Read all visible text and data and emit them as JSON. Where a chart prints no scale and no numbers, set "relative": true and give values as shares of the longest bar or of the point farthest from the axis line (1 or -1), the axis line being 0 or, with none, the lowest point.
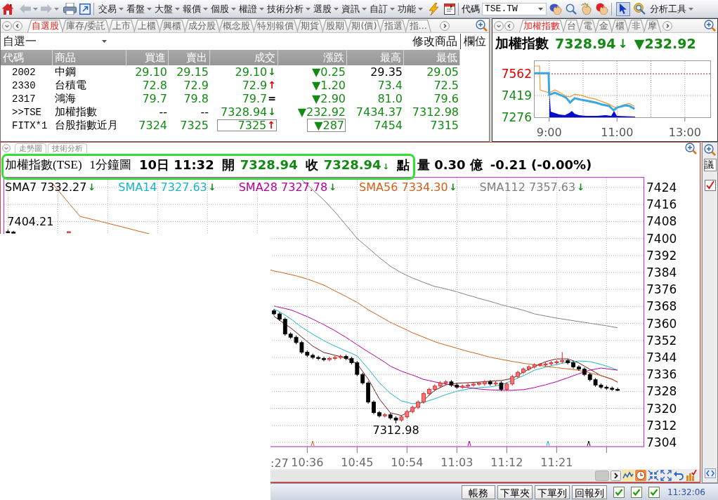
{
  "toolbar": {
    "back": {
      "disabled": true
    },
    "forward": {
      "disabled": true
    },
    "menus": [
      "交易",
      "看盤",
      "大盤",
      "報價",
      "個股",
      "權證",
      "技術分析",
      "選股",
      "資訊",
      "自訂",
      "功能"
    ],
    "code_label": "代碼",
    "code_value": "TSE.TW",
    "pointer_active": true,
    "tools_menu": "分析工具"
  },
  "watchlist": {
    "tabs": [
      {
        "label": "自選股",
        "selected": true
      },
      {
        "label": "庫存/委託",
        "selected": false
      },
      {
        "label": "上市",
        "selected": false
      },
      {
        "label": "上櫃",
        "selected": false
      },
      {
        "label": "興櫃",
        "selected": false
      },
      {
        "label": "成分股",
        "selected": false
      },
      {
        "label": "概念股",
        "selected": false
      },
      {
        "label": "特別報價",
        "selected": false
      },
      {
        "label": "期貨",
        "selected": false
      },
      {
        "label": "股期",
        "selected": false
      },
      {
        "label": "期(價)",
        "selected": false
      },
      {
        "label": "指選",
        "selected": false
      },
      {
        "label": "指...",
        "selected": false
      }
    ],
    "list_name": "自選一",
    "buttons": [
      "修改商品",
      "欄位"
    ],
    "columns": [
      "代碼",
      "商品",
      "買進",
      "賣出",
      "成交",
      "漲跌",
      "最高",
      "最低"
    ],
    "rows": [
      {
        "highlighted": false,
        "cells": [
          {
            "text": "2002",
            "color": "#000000"
          },
          {
            "text": "中鋼",
            "color": "#000000"
          },
          {
            "text": "29.10",
            "color": "#138a13"
          },
          {
            "text": "29.15",
            "color": "#138a13"
          },
          {
            "text": "29.10",
            "color": "#138a13",
            "tick": {
              "text": "↓",
              "color": "#138a13"
            }
          },
          {
            "text": "▼0.25",
            "color": "#138a13"
          },
          {
            "text": "29.35",
            "color": "#000000"
          },
          {
            "text": "29.05",
            "color": "#138a13"
          }
        ]
      },
      {
        "highlighted": false,
        "cells": [
          {
            "text": "2330",
            "color": "#000000"
          },
          {
            "text": "台積電",
            "color": "#000000"
          },
          {
            "text": "72.8",
            "color": "#138a13"
          },
          {
            "text": "72.9",
            "color": "#138a13"
          },
          {
            "text": "72.9",
            "color": "#138a13",
            "tick": {
              "text": "↑",
              "color": "#e00000"
            }
          },
          {
            "text": "▼1.20",
            "color": "#138a13"
          },
          {
            "text": "73.4",
            "color": "#138a13"
          },
          {
            "text": "72.5",
            "color": "#138a13"
          }
        ]
      },
      {
        "highlighted": false,
        "cells": [
          {
            "text": "2317",
            "color": "#000000"
          },
          {
            "text": "鴻海",
            "color": "#000000"
          },
          {
            "text": "79.7",
            "color": "#138a13"
          },
          {
            "text": "79.8",
            "color": "#138a13"
          },
          {
            "text": "79.7",
            "color": "#138a13",
            "tick": {
              "text": "=",
              "color": "#000000"
            }
          },
          {
            "text": "▼2.90",
            "color": "#138a13"
          },
          {
            "text": "81.0",
            "color": "#138a13"
          },
          {
            "text": "79.6",
            "color": "#138a13"
          }
        ]
      },
      {
        "highlighted": false,
        "cells": [
          {
            "text": ">>TSE",
            "color": "#000000"
          },
          {
            "text": "加權指數",
            "color": "#000000"
          },
          {
            "text": "--",
            "color": "#000000"
          },
          {
            "text": "--",
            "color": "#000000"
          },
          {
            "text": "7328.94",
            "color": "#138a13",
            "tick": {
              "text": "↓",
              "color": "#138a13"
            }
          },
          {
            "text": "▼232.92",
            "color": "#138a13"
          },
          {
            "text": "7434.37",
            "color": "#138a13"
          },
          {
            "text": "7312.98",
            "color": "#138a13"
          }
        ]
      },
      {
        "highlighted": true,
        "cells": [
          {
            "text": "FITX*1",
            "color": "#000000"
          },
          {
            "text": "台股指數近月",
            "color": "#000000"
          },
          {
            "text": "7324",
            "color": "#138a13"
          },
          {
            "text": "7325",
            "color": "#138a13"
          },
          {
            "text": "7325",
            "color": "#138a13",
            "tick": {
              "text": "↑",
              "color": "#e00000"
            }
          },
          {
            "text": "▼287",
            "color": "#138a13"
          },
          {
            "text": "7454",
            "color": "#138a13"
          },
          {
            "text": "7315",
            "color": "#138a13"
          }
        ]
      }
    ]
  },
  "index_panel": {
    "tabs": [
      {
        "label": "加權指數",
        "selected": true
      },
      {
        "label": "台",
        "selected": false
      },
      {
        "label": "電",
        "selected": false
      },
      {
        "label": "金",
        "selected": false
      },
      {
        "label": "櫃",
        "selected": false
      },
      {
        "label": "非",
        "selected": false
      },
      {
        "label": "摩",
        "selected": false
      }
    ],
    "name": "加權指數",
    "value": "7328.94",
    "arrow": "↓",
    "change": "▼232.92",
    "chart_data": {
      "type": "line",
      "x": [
        514,
        523,
        524,
        531,
        539,
        540,
        550,
        562,
        570,
        577,
        585,
        597,
        610,
        622,
        634,
        646,
        654,
        661,
        668,
        674,
        682,
        691
      ],
      "series": [
        {
          "color": "#f09a30",
          "values": [
            7613,
            7613,
            7456,
            7447,
            7438,
            7437,
            7456,
            7433,
            7415,
            7410,
            7428,
            7421,
            7405,
            7395,
            7378,
            7362,
            7345,
            7338,
            7354,
            7360,
            7366,
            7347
          ]
        },
        {
          "color": "#3aa8e0",
          "values": [
            7566,
            7566,
            7566,
            7566,
            7566,
            7424,
            7437,
            7419,
            7405,
            7373,
            7401,
            7391,
            7382,
            7373,
            7359,
            7350,
            7322,
            7341,
            7347,
            7354,
            7350,
            7331
          ]
        }
      ],
      "xlim": [
        513,
        825
      ],
      "ylim": [
        7276,
        7650
      ],
      "xticks": [
        {
          "value": 540,
          "label": "9:00"
        },
        {
          "value": 660,
          "label": "11:00"
        },
        {
          "value": 780,
          "label": "13:00"
        }
      ],
      "yticks": [
        {
          "value": 7276,
          "label": "7276"
        },
        {
          "value": 7419,
          "label": "7419"
        },
        {
          "value": 7562,
          "label": "7562"
        }
      ],
      "grid": true,
      "ref_lines": [
        {
          "axis": "y",
          "value": 7562
        }
      ]
    }
  },
  "chart_panel": {
    "tabs": [
      "走勢圖",
      "技術分析"
    ],
    "header": {
      "symbol": "加權指數(TSE)",
      "interval": "1分鐘圖",
      "time": "10日 11:32",
      "open_label": "開",
      "open": "7328.94",
      "close_label": "收",
      "close": "7328.94",
      "close_arrow": "↓",
      "unit": "點",
      "volume": "量 0.30 億",
      "change": "-0.21 (-0.00%)"
    },
    "legend": [
      {
        "label": "SMA7 7332.27",
        "color": "#000000",
        "arrow": "↓"
      },
      {
        "label": "SMA14 7327.63",
        "color": "#18b4c8",
        "arrow": "↓"
      },
      {
        "label": "SMA28 7327.78",
        "color": "#b4009c",
        "arrow": "↓"
      },
      {
        "label": "SMA56 7334.30",
        "color": "#d0601a",
        "arrow": "↓"
      },
      {
        "label": "SMA112 7357.63",
        "color": "#808080",
        "arrow": "↓"
      }
    ],
    "chart_data": {
      "type": "candlestick",
      "x": [
        582,
        583,
        593,
        630,
        631,
        632,
        633,
        634,
        635,
        636,
        637,
        638,
        639,
        640,
        641,
        642,
        643,
        644,
        645,
        646,
        647,
        648,
        649,
        650,
        651,
        652,
        653,
        654,
        655,
        656,
        657,
        658,
        659,
        660,
        661,
        662,
        663,
        664,
        665,
        666,
        667,
        668,
        669,
        670,
        671,
        672,
        673,
        674,
        675,
        676,
        677,
        678,
        679,
        680,
        681,
        682,
        683,
        684,
        685,
        686,
        687,
        688,
        689,
        690,
        691,
        692
      ],
      "ohlc": [
        [
          7403.2,
          7404.21,
          7402.7,
          7402.8
        ],
        [
          7403.0,
          7403.6,
          7402.7,
          7402.9
        ],
        [
          7402.8,
          7403.4,
          7402.7,
          7403.2
        ],
        [
          7366,
          7366.8,
          7363.7,
          7364.5
        ],
        [
          7364.5,
          7365.3,
          7361.2,
          7362
        ],
        [
          7362,
          7362.8,
          7354.2,
          7355
        ],
        [
          7355,
          7355.8,
          7352.7,
          7353.5
        ],
        [
          7353.5,
          7354.3,
          7350.2,
          7351
        ],
        [
          7351,
          7351.8,
          7345.7,
          7346.5
        ],
        [
          7346.5,
          7347.3,
          7344.2,
          7345
        ],
        [
          7345,
          7345.8,
          7343.2,
          7344
        ],
        [
          7344,
          7344.8,
          7342.7,
          7343.5
        ],
        [
          7343.5,
          7344.3,
          7342.2,
          7343
        ],
        [
          7343,
          7344.3,
          7342.2,
          7343.5
        ],
        [
          7343.5,
          7344.8,
          7342.7,
          7344
        ],
        [
          7344,
          7345.3,
          7343.2,
          7344.5
        ],
        [
          7344.5,
          7345.3,
          7342.7,
          7343.5
        ],
        [
          7343.5,
          7344.3,
          7340.7,
          7341.5
        ],
        [
          7341.5,
          7342.3,
          7335.2,
          7336
        ],
        [
          7336,
          7336.8,
          7331.2,
          7332
        ],
        [
          7332,
          7332.8,
          7322.2,
          7323
        ],
        [
          7323,
          7323.8,
          7317.2,
          7318
        ],
        [
          7318,
          7318.8,
          7315.7,
          7316.5
        ],
        [
          7316.5,
          7317.8,
          7315.7,
          7317
        ],
        [
          7317,
          7317.8,
          7314.7,
          7315.5
        ],
        [
          7315.5,
          7316.3,
          7312.98,
          7314.5
        ],
        [
          7314.5,
          7316.8,
          7313.7,
          7316
        ],
        [
          7316,
          7319.3,
          7315.2,
          7318.5
        ],
        [
          7318.5,
          7321.3,
          7317.7,
          7320.5
        ],
        [
          7320.5,
          7323.8,
          7319.7,
          7323
        ],
        [
          7323,
          7327.8,
          7322.2,
          7327
        ],
        [
          7327,
          7329.8,
          7326.2,
          7329
        ],
        [
          7329,
          7331.3,
          7328.2,
          7330.5
        ],
        [
          7330.5,
          7332.8,
          7329.7,
          7332
        ],
        [
          7332,
          7333.3,
          7331.2,
          7332.5
        ],
        [
          7332.5,
          7333.3,
          7330.2,
          7331
        ],
        [
          7331,
          7331.8,
          7329.2,
          7330
        ],
        [
          7330,
          7331.3,
          7329.2,
          7330.5
        ],
        [
          7330.5,
          7331.8,
          7329.7,
          7331
        ],
        [
          7331,
          7332.3,
          7330.2,
          7331.5
        ],
        [
          7331.5,
          7332.3,
          7330.7,
          7331.9
        ],
        [
          7331.5,
          7333.3,
          7330.7,
          7332.5
        ],
        [
          7332.5,
          7333.3,
          7330.7,
          7331.5
        ],
        [
          7331.5,
          7332.8,
          7330.7,
          7332
        ],
        [
          7332,
          7332.8,
          7328.2,
          7329
        ],
        [
          7329,
          7332.3,
          7328.2,
          7331.5
        ],
        [
          7331.5,
          7335.8,
          7330.7,
          7335
        ],
        [
          7335,
          7337.8,
          7334.2,
          7337
        ],
        [
          7337,
          7339.3,
          7336.2,
          7338.5
        ],
        [
          7338.5,
          7340.3,
          7337.7,
          7339.5
        ],
        [
          7339.5,
          7341.3,
          7338.7,
          7340.5
        ],
        [
          7340.5,
          7341.3,
          7339.7,
          7340.9
        ],
        [
          7340.5,
          7341.8,
          7339.7,
          7341
        ],
        [
          7341,
          7342.3,
          7340.2,
          7341.5
        ],
        [
          7341.5,
          7342.8,
          7340.7,
          7342
        ],
        [
          7342,
          7346.5,
          7341.2,
          7342.5
        ],
        [
          7342.5,
          7343.3,
          7340.7,
          7341.5
        ],
        [
          7341.5,
          7342.3,
          7338.7,
          7339.5
        ],
        [
          7339.5,
          7340.3,
          7337.7,
          7338.5
        ],
        [
          7338.5,
          7339.3,
          7335.2,
          7336
        ],
        [
          7336,
          7336.8,
          7332.7,
          7333.5
        ],
        [
          7333.5,
          7334.3,
          7330.2,
          7331
        ],
        [
          7331,
          7331.8,
          7329.2,
          7330
        ],
        [
          7330,
          7330.8,
          7328.7,
          7329.5
        ],
        [
          7329.5,
          7330.3,
          7328.2,
          7329
        ],
        [
          7329,
          7329.8,
          7328.1,
          7328.94
        ]
      ],
      "xlim": [
        581.2,
        696.8
      ],
      "ylim": [
        7302,
        7428.8
      ],
      "xticks": [
        {
          "value": 636,
          "label": "10:36"
        },
        {
          "value": 645,
          "label": "10:45"
        },
        {
          "value": 654,
          "label": "10:54"
        },
        {
          "value": 663,
          "label": "11:03"
        },
        {
          "value": 672,
          "label": "11:12"
        },
        {
          "value": 681,
          "label": "11:21"
        }
      ],
      "yticks": [
        7424,
        7416,
        7408,
        7400,
        7392,
        7384,
        7376,
        7368,
        7360,
        7352,
        7344,
        7336,
        7328,
        7320,
        7312,
        7304
      ],
      "grid": true,
      "annotations": [
        "7404.21",
        "7312.98"
      ]
    },
    "moving_averages": {
      "chart_data": {
        "type": "line",
        "relative": true,
        "x": [
          590,
          593,
          595,
          601,
          607,
          630,
          631,
          632,
          633,
          634,
          635,
          636,
          637,
          638,
          639,
          640,
          641,
          642,
          643,
          644,
          645,
          646,
          647,
          648,
          649,
          650,
          651,
          652,
          653,
          654,
          655,
          656,
          657,
          658,
          659,
          660,
          661,
          662,
          663,
          664,
          665,
          666,
          667,
          668,
          669,
          670,
          671,
          672,
          673,
          674,
          675,
          676,
          677,
          678,
          679,
          680,
          681,
          682,
          683,
          684,
          685,
          686,
          687,
          688,
          689,
          690,
          691,
          692
        ],
        "series": [
          {
            "color": "#701818",
            "values": [
              null,
              null,
              null,
              null,
              null,
              7363.4,
              7361.5,
              7359.7,
              7357.9,
              7355.8,
              7353.6,
              7351.5,
              7349.3,
              7347.8,
              7346.3,
              7345.7,
              7345.0,
              7344.4,
              7343.7,
              7342.4,
              7341.0,
              7337.4,
              7333.8,
              7329.2,
              7324.5,
              7321.2,
              7317.9,
              7317.3,
              7316.6,
              7317.9,
              7319.2,
              7321.5,
              7323.8,
              7326.2,
              7328.5,
              7329.8,
              7331.1,
              7331.5,
              7331.8,
              7332.0,
              7332.1,
              7332.3,
              7332.4,
              7332.6,
              7332.8,
              7333.0,
              7333.1,
              7333.6,
              7334.1,
              7335.6,
              7337.1,
              7338.4,
              7339.7,
              7340.9,
              7342.0,
              7342.7,
              7343.3,
              7343.3,
              7343.3,
              7342.4,
              7341.4,
              7339.9,
              7338.4,
              7336.9,
              7335.4,
              7334.6,
              7333.8,
              7332.3
            ]
          },
          {
            "color": "#18b4c8",
            "values": [
              null,
              null,
              null,
              null,
              null,
              7366.8,
              7365.5,
              7363.9,
              7362.2,
              7360.2,
              7358.2,
              7356.6,
              7354.9,
              7353.4,
              7351.9,
              7350.6,
              7349.3,
              7348.2,
              7347.0,
              7345.9,
              7344.7,
              7341.7,
              7338.7,
              7335.4,
              7332.1,
              7329.6,
              7327.1,
              7325.3,
              7323.5,
              7322.9,
              7322.2,
              7322.5,
              7322.8,
              7323.7,
              7324.5,
              7325.5,
              7326.5,
              7327.3,
              7328.1,
              7328.6,
              7329.1,
              7329.5,
              7329.8,
              7330.0,
              7330.1,
              7330.6,
              7331.1,
              7332.1,
              7333.1,
              7334.3,
              7335.4,
              7336.7,
              7338.0,
              7338.7,
              7339.4,
              7340.1,
              7340.7,
              7341.2,
              7341.7,
              7342.0,
              7342.3,
              7342.2,
              7342.0,
              7341.4,
              7340.7,
              7339.9,
              7339.0,
              7338.0
            ]
          },
          {
            "color": "#b4009c",
            "values": [
              null,
              null,
              null,
              null,
              null,
              7368.2,
              7367.6,
              7367.0,
              7366.4,
              7365.4,
              7364.3,
              7363.2,
              7362.0,
              7360.7,
              7359.4,
              7358.0,
              7356.6,
              7355.0,
              7353.4,
              7351.7,
              7350.0,
              7348.3,
              7346.6,
              7345.0,
              7343.4,
              7341.7,
              7339.9,
              7338.7,
              7337.5,
              7336.6,
              7335.7,
              7334.7,
              7333.6,
              7333.1,
              7332.5,
              7332.0,
              7331.5,
              7331.0,
              7330.4,
              7330.1,
              7329.8,
              7329.5,
              7329.1,
              7328.9,
              7328.7,
              7328.6,
              7328.5,
              7328.5,
              7328.5,
              7328.7,
              7328.8,
              7329.3,
              7329.8,
              7330.5,
              7331.1,
              7331.9,
              7332.6,
              7333.5,
              7334.4,
              7335.4,
              7336.3,
              7337.2,
              7338.0,
              7338.5,
              7339.0,
              7338.7,
              7338.3,
              7338.0
            ]
          },
          {
            "color": "#d0601a",
            "values": [
              7426.0,
              7416.6,
              7410.4,
              7406.5,
              7402.5,
              7384.7,
              7384.2,
              7383.6,
              7383.0,
              7382.4,
              7381.7,
              7380.9,
              7380.0,
              7379.0,
              7378.0,
              7376.7,
              7375.3,
              7374.0,
              7372.7,
              7371.3,
              7369.9,
              7368.2,
              7366.4,
              7365.0,
              7363.5,
              7362.0,
              7360.5,
              7359.3,
              7358.1,
              7356.9,
              7355.6,
              7354.6,
              7353.5,
              7352.5,
              7351.4,
              7350.6,
              7349.8,
              7349.1,
              7348.3,
              7347.6,
              7346.8,
              7346.2,
              7345.5,
              7344.8,
              7344.1,
              7343.6,
              7343.1,
              7342.6,
              7342.1,
              7341.7,
              7341.2,
              7340.9,
              7340.5,
              7340.2,
              7339.8,
              7339.5,
              7339.2,
              7338.9,
              7338.6,
              7338.3,
              7337.9,
              7337.3,
              7336.7,
              7336.1,
              7335.5,
              7334.6,
              7333.6,
              7332.5
            ]
          },
          {
            "color": "#808080",
            "values": [
              null,
              null,
              null,
              null,
              null,
              null,
              null,
              null,
              null,
              null,
              7427.7,
              7425.3,
              7422.9,
              7420.5,
              7418.1,
              7415.3,
              7412.5,
              7409.4,
              7406.3,
              7403.2,
              7400.0,
              7397.8,
              7395.6,
              7393.3,
              7391.0,
              7389.0,
              7386.9,
              7385.4,
              7383.8,
              7382.6,
              7381.4,
              7380.4,
              7379.3,
              7378.4,
              7377.4,
              7376.9,
              7376.3,
              7375.6,
              7374.9,
              7374.1,
              7373.3,
              7372.6,
              7371.8,
              7371.1,
              7370.4,
              7369.6,
              7368.8,
              7368.2,
              7367.5,
              7366.9,
              7366.2,
              7365.4,
              7364.5,
              7364.0,
              7363.5,
              7363.0,
              7362.5,
              7362.1,
              7361.7,
              7361.3,
              7360.9,
              7360.5,
              7360.1,
              7359.7,
              7359.3,
              7358.9,
              7358.4,
              7358.0
            ]
          }
        ],
        "xlim": [
          581.2,
          696.8
        ],
        "ylim": [
          7302,
          7428.8
        ]
      }
    },
    "cut_tick_label": ":27",
    "side_button": "議"
  },
  "status_bar": {
    "buttons": [
      "帳務",
      "下單夾",
      "下單列",
      "回報列"
    ],
    "checks": [
      {
        "checked": true
      },
      {
        "checked": true
      },
      {
        "checked": true
      }
    ],
    "time": "11:32:06"
  }
}
